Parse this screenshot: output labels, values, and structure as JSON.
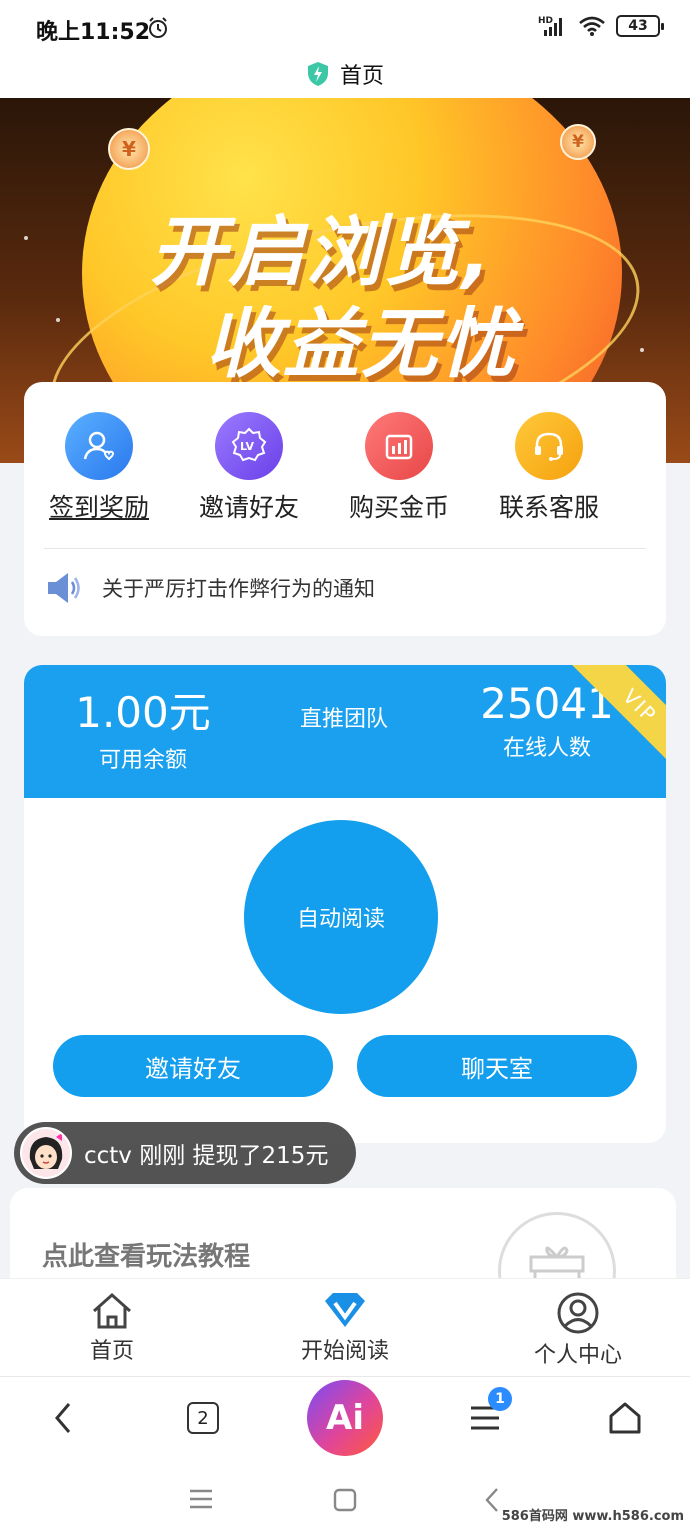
{
  "status_bar": {
    "time": "晚上11:52",
    "network": "HD",
    "battery": "43"
  },
  "title_bar": {
    "title": "首页"
  },
  "banner": {
    "line1": "开启浏览,",
    "line2": "收益无忧",
    "coin_symbol": "¥"
  },
  "quick_actions": [
    {
      "label": "签到奖励",
      "icon": "user-heart-icon",
      "color": "#3f8ff5"
    },
    {
      "label": "邀请好友",
      "icon": "lv-badge-icon",
      "color": "#7a55f0"
    },
    {
      "label": "购买金币",
      "icon": "chart-box-icon",
      "color": "#f05a5a"
    },
    {
      "label": "联系客服",
      "icon": "headset-icon",
      "color": "#f5a623"
    }
  ],
  "notice": {
    "icon": "speaker-icon",
    "text": "关于严厉打击作弊行为的通知"
  },
  "stats": {
    "balance_value": "1.00元",
    "balance_label": "可用余额",
    "team_label": "直推团队",
    "online_value": "25041",
    "online_label": "在线人数",
    "vip_label": "VIP"
  },
  "actions": {
    "auto_read": "自动阅读",
    "invite": "邀请好友",
    "chat": "聊天室"
  },
  "toast": {
    "message": "cctv 刚刚 提现了215元"
  },
  "tutorial": {
    "label": "点此查看玩法教程"
  },
  "bottom_nav": [
    {
      "label": "首页",
      "icon": "home-icon"
    },
    {
      "label": "开始阅读",
      "icon": "diamond-v-icon"
    },
    {
      "label": "个人中心",
      "icon": "user-circle-icon"
    }
  ],
  "browser_bar": {
    "tab_count": "2",
    "ai_label": "Ai",
    "menu_badge": "1"
  },
  "watermark": "586首码网 www.h586.com",
  "colors": {
    "primary": "#139fed",
    "stats_bg": "#1aa0ee",
    "vip": "#f5d548"
  }
}
